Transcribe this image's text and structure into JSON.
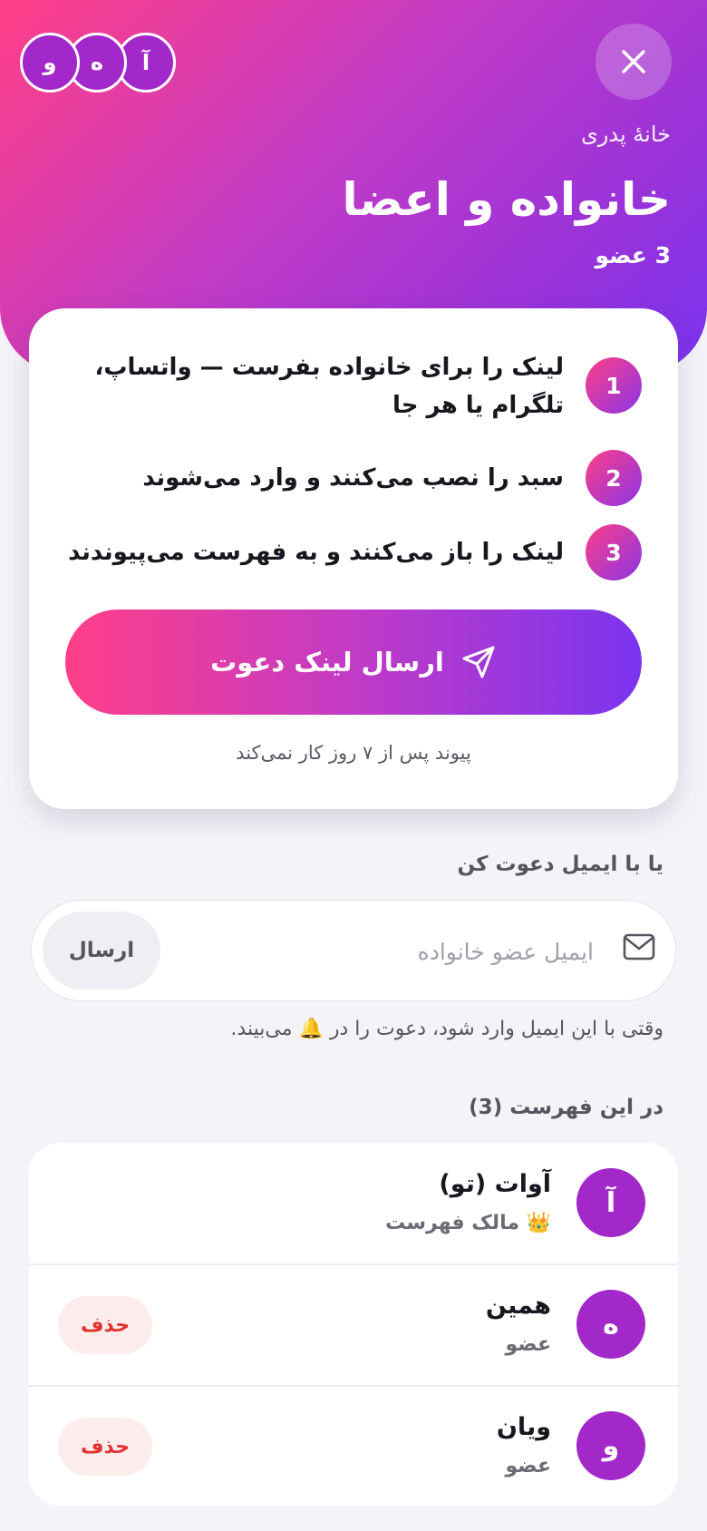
{
  "header": {
    "subtitle": "خانهٔ پدری",
    "title": "خانواده و اعضا",
    "member_count": "3 عضو",
    "avatars": [
      "آ",
      "ه",
      "و"
    ]
  },
  "steps": [
    {
      "number": "1",
      "text": "لینک را برای خانواده بفرست — واتساپ، تلگرام یا هر جا"
    },
    {
      "number": "2",
      "text": "سبد را نصب می‌کنند و وارد می‌شوند"
    },
    {
      "number": "3",
      "text": "لینک را باز می‌کنند و به فهرست می‌پیوندند"
    }
  ],
  "invite": {
    "button_label": "ارسال لینک دعوت",
    "expiry_note": "پیوند پس از ۷ روز کار نمی‌کند"
  },
  "email_invite": {
    "section_label": "یا با ایمیل دعوت کن",
    "placeholder": "ایمیل عضو خانواده",
    "value": "",
    "send_label": "ارسال",
    "hint": "وقتی با این ایمیل وارد شود، دعوت را در 🔔 می‌بیند."
  },
  "members_section": {
    "label": "در این فهرست (3)",
    "members": [
      {
        "initial": "آ",
        "name": "آوات (تو)",
        "role": "👑 مالک فهرست",
        "removable": false
      },
      {
        "initial": "ه",
        "name": "همین",
        "role": "عضو",
        "removable": true,
        "remove_label": "حذف"
      },
      {
        "initial": "و",
        "name": "ویان",
        "role": "عضو",
        "removable": true,
        "remove_label": "حذف"
      }
    ]
  },
  "colors": {
    "gradient_start": "#ff3f87",
    "gradient_end": "#7a34f0",
    "avatar": "#a228c9",
    "danger": "#e0322e"
  }
}
